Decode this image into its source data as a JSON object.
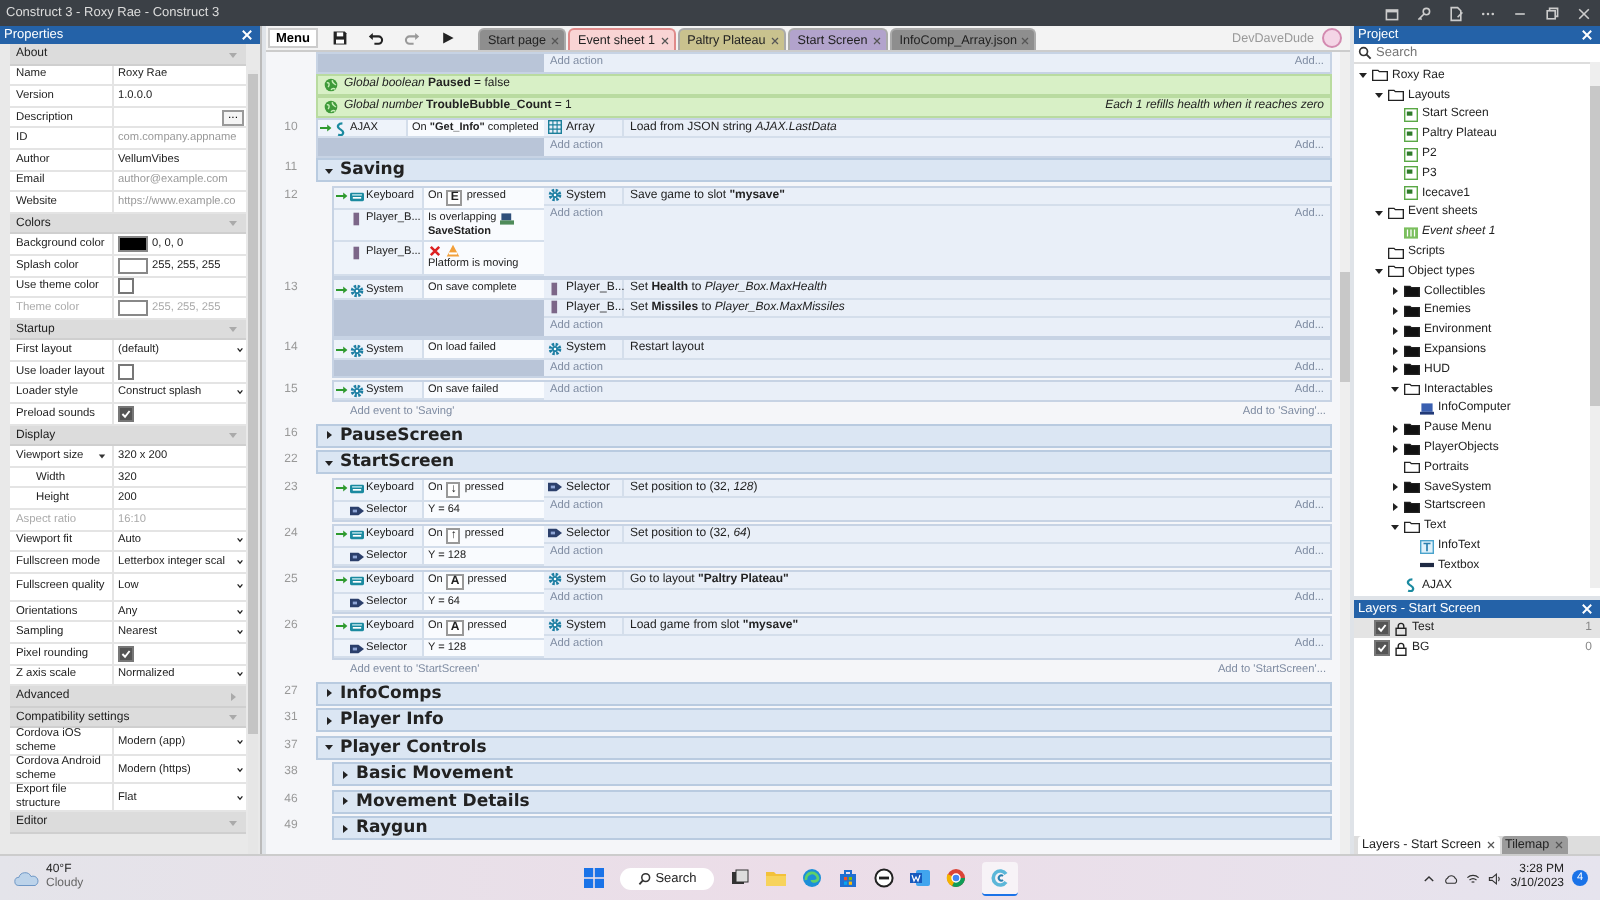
{
  "window": {
    "title": "Construct 3 - Roxy Rae - Construct 3"
  },
  "properties": {
    "title": "Properties",
    "sections": [
      {
        "name": "About",
        "expanded": true,
        "rows": [
          {
            "label": "Name",
            "kind": "text",
            "value": "Roxy Rae",
            "disabled": false
          },
          {
            "label": "Version",
            "kind": "text",
            "value": "1.0.0.0",
            "disabled": false
          },
          {
            "label": "Description",
            "kind": "button",
            "value": "...",
            "disabled": false
          },
          {
            "label": "ID",
            "kind": "text",
            "placeholder": "com.company.appname",
            "disabled": false
          },
          {
            "label": "Author",
            "kind": "text",
            "value": "VellumVibes",
            "disabled": false
          },
          {
            "label": "Email",
            "kind": "text",
            "placeholder": "author@example.com",
            "disabled": false
          },
          {
            "label": "Website",
            "kind": "text",
            "placeholder": "https://www.example.co",
            "disabled": false
          }
        ]
      },
      {
        "name": "Colors",
        "expanded": true,
        "rows": [
          {
            "label": "Background color",
            "kind": "color",
            "color": "#000000",
            "value": "0, 0, 0",
            "disabled": false
          },
          {
            "label": "Splash color",
            "kind": "color",
            "color": "#ffffff",
            "value": "255, 255, 255",
            "disabled": false
          },
          {
            "label": "Use theme color",
            "kind": "checkbox",
            "checked": false,
            "disabled": false
          },
          {
            "label": "Theme color",
            "kind": "color",
            "color": "#ffffff",
            "value": "255, 255, 255",
            "disabled": true
          }
        ]
      },
      {
        "name": "Startup",
        "expanded": true,
        "rows": [
          {
            "label": "First layout",
            "kind": "dropdown",
            "value": "(default)",
            "disabled": false
          },
          {
            "label": "Use loader layout",
            "kind": "checkbox",
            "checked": false,
            "disabled": false
          },
          {
            "label": "Loader style",
            "kind": "dropdown",
            "value": "Construct splash",
            "disabled": false
          },
          {
            "label": "Preload sounds",
            "kind": "checkbox",
            "checked": true,
            "disabled": false
          }
        ]
      },
      {
        "name": "Display",
        "expanded": true,
        "rows": [
          {
            "label": "Viewport size",
            "kind": "text",
            "value": "320 x 200",
            "disabled": false,
            "expanded": true,
            "children": [
              {
                "label": "Width",
                "kind": "text",
                "value": "320",
                "disabled": false
              },
              {
                "label": "Height",
                "kind": "text",
                "value": "200",
                "disabled": false
              }
            ]
          },
          {
            "label": "Aspect ratio",
            "kind": "text",
            "value": "16:10",
            "disabled": true
          },
          {
            "label": "Viewport fit",
            "kind": "dropdown",
            "value": "Auto",
            "disabled": false
          },
          {
            "label": "Fullscreen mode",
            "kind": "dropdown",
            "value": "Letterbox integer scal",
            "disabled": false
          },
          {
            "label": "Fullscreen quality",
            "kind": "dropdown",
            "value": "Low",
            "disabled": false
          },
          {
            "label": "Orientations",
            "kind": "dropdown",
            "value": "Any",
            "disabled": false
          },
          {
            "label": "Sampling",
            "kind": "dropdown",
            "value": "Nearest",
            "disabled": false
          },
          {
            "label": "Pixel rounding",
            "kind": "checkbox",
            "checked": true,
            "disabled": false
          },
          {
            "label": "Z axis scale",
            "kind": "dropdown",
            "value": "Normalized",
            "disabled": false
          }
        ]
      },
      {
        "name": "Advanced",
        "expanded": false
      },
      {
        "name": "Compatibility settings",
        "expanded": true,
        "rows": [
          {
            "label": "Cordova iOS scheme",
            "kind": "dropdown",
            "value": "Modern (app)",
            "disabled": false
          },
          {
            "label": "Cordova Android scheme",
            "kind": "dropdown",
            "value": "Modern (https)",
            "disabled": false
          },
          {
            "label": "Export file structure",
            "kind": "dropdown",
            "value": "Flat",
            "disabled": false
          }
        ]
      },
      {
        "name": "Editor",
        "expanded": true
      }
    ]
  },
  "toolbar": {
    "menu": "Menu",
    "user": "DevDaveDude"
  },
  "tabs": [
    {
      "label": "Start page",
      "selected": false,
      "color": "#8e8e8e"
    },
    {
      "label": "Event sheet 1",
      "selected": true,
      "color": "#f9d4d4"
    },
    {
      "label": "Paltry Plateau",
      "selected": false,
      "color": "#c9c28e"
    },
    {
      "label": "Start Screen",
      "selected": false,
      "color": "#b2a3cc"
    },
    {
      "label": "InfoComp_Array.json",
      "selected": false,
      "color": "#8e8e8e"
    }
  ],
  "event_sheet": {
    "blocks": [
      {
        "kind": "add-action",
        "text": "Add action",
        "more": "Add..."
      },
      {
        "kind": "global",
        "text": "*Global boolean* **Paused** = false"
      },
      {
        "kind": "global",
        "text": "*Global number* **TroubleBubble_Count** = 1",
        "comment": "Each 1 refills health when it reaches zero"
      },
      {
        "kind": "event",
        "number": "10",
        "conditions": [
          {
            "kind": "plain",
            "object": {
              "name": "AJAX",
              "kind": "ajax"
            },
            "inverted": false,
            "text": "On **\"Get_Info\"** completed"
          }
        ],
        "actions": [
          {
            "object": {
              "name": "Array",
              "kind": "array"
            },
            "text": "Load from JSON string *AJAX.LastData*"
          }
        ],
        "add_action": "Add action",
        "add_more": "Add..."
      },
      {
        "kind": "group",
        "number": "11",
        "title": "Saving",
        "expanded": true,
        "add_event": "Add event to 'Saving'",
        "add_more": "Add to 'Saving'...",
        "children": [
          {
            "kind": "event",
            "number": "12",
            "conditions": [
              {
                "kind": "key",
                "object": {
                  "name": "Keyboard",
                  "kind": "keyboard"
                },
                "inverted": false,
                "prefix": "On",
                "key": "E",
                "suffix": "pressed"
              },
              {
                "kind": "overlap",
                "object": {
                  "name": "Player_B...",
                  "kind": "sprite"
                },
                "inverted": false,
                "text": "Is overlapping",
                "target": "SaveStation"
              },
              {
                "kind": "behavior",
                "object": {
                  "name": "Player_B...",
                  "kind": "sprite"
                },
                "inverted": true,
                "text": "Platform is moving"
              }
            ],
            "actions": [
              {
                "object": {
                  "name": "System",
                  "kind": "system"
                },
                "text": "Save game to slot **\"mysave\"**"
              }
            ],
            "add_action": "Add action",
            "add_more": "Add..."
          },
          {
            "kind": "event",
            "number": "13",
            "conditions": [
              {
                "kind": "plain",
                "object": {
                  "name": "System",
                  "kind": "system"
                },
                "inverted": false,
                "text": "On save complete"
              }
            ],
            "actions": [
              {
                "object": {
                  "name": "Player_B...",
                  "kind": "sprite"
                },
                "text": "Set **Health** to *Player_Box.MaxHealth*"
              },
              {
                "object": {
                  "name": "Player_B...",
                  "kind": "sprite"
                },
                "text": "Set **Missiles** to *Player_Box.MaxMissiles*"
              }
            ],
            "add_action": "Add action",
            "add_more": "Add..."
          },
          {
            "kind": "event",
            "number": "14",
            "conditions": [
              {
                "kind": "plain",
                "object": {
                  "name": "System",
                  "kind": "system"
                },
                "inverted": false,
                "text": "On load failed"
              }
            ],
            "actions": [
              {
                "object": {
                  "name": "System",
                  "kind": "system"
                },
                "text": "Restart layout"
              }
            ],
            "add_action": "Add action",
            "add_more": "Add..."
          },
          {
            "kind": "event",
            "number": "15",
            "conditions": [
              {
                "kind": "plain",
                "object": {
                  "name": "System",
                  "kind": "system"
                },
                "inverted": false,
                "text": "On save failed"
              }
            ],
            "add_action": "Add action",
            "add_more": "Add..."
          }
        ]
      },
      {
        "kind": "group",
        "number": "16",
        "title": "PauseScreen",
        "expanded": false
      },
      {
        "kind": "group",
        "number": "22",
        "title": "StartScreen",
        "expanded": true,
        "add_event": "Add event to 'StartScreen'",
        "add_more": "Add to 'StartScreen'...",
        "children": [
          {
            "kind": "event",
            "number": "23",
            "conditions": [
              {
                "kind": "key",
                "object": {
                  "name": "Keyboard",
                  "kind": "keyboard"
                },
                "inverted": false,
                "prefix": "On",
                "key": "↓",
                "suffix": "pressed"
              },
              {
                "kind": "plain",
                "object": {
                  "name": "Selector",
                  "kind": "selector"
                },
                "inverted": false,
                "text": "Y = 64"
              }
            ],
            "actions": [
              {
                "object": {
                  "name": "Selector",
                  "kind": "selector"
                },
                "text": "Set position to (32, *128*)"
              }
            ],
            "add_action": "Add action",
            "add_more": "Add..."
          },
          {
            "kind": "event",
            "number": "24",
            "conditions": [
              {
                "kind": "key",
                "object": {
                  "name": "Keyboard",
                  "kind": "keyboard"
                },
                "inverted": false,
                "prefix": "On",
                "key": "↑",
                "suffix": "pressed"
              },
              {
                "kind": "plain",
                "object": {
                  "name": "Selector",
                  "kind": "selector"
                },
                "inverted": false,
                "text": "Y = 128"
              }
            ],
            "actions": [
              {
                "object": {
                  "name": "Selector",
                  "kind": "selector"
                },
                "text": "Set position to (32, *64*)"
              }
            ],
            "add_action": "Add action",
            "add_more": "Add..."
          },
          {
            "kind": "event",
            "number": "25",
            "conditions": [
              {
                "kind": "key",
                "object": {
                  "name": "Keyboard",
                  "kind": "keyboard"
                },
                "inverted": false,
                "prefix": "On",
                "key": "A",
                "suffix": "pressed"
              },
              {
                "kind": "plain",
                "object": {
                  "name": "Selector",
                  "kind": "selector"
                },
                "inverted": false,
                "text": "Y = 64"
              }
            ],
            "actions": [
              {
                "object": {
                  "name": "System",
                  "kind": "system"
                },
                "text": "Go to layout **\"Paltry Plateau\"**"
              }
            ],
            "add_action": "Add action",
            "add_more": "Add..."
          },
          {
            "kind": "event",
            "number": "26",
            "conditions": [
              {
                "kind": "key",
                "object": {
                  "name": "Keyboard",
                  "kind": "keyboard"
                },
                "inverted": false,
                "prefix": "On",
                "key": "A",
                "suffix": "pressed"
              },
              {
                "kind": "plain",
                "object": {
                  "name": "Selector",
                  "kind": "selector"
                },
                "inverted": false,
                "text": "Y = 128"
              }
            ],
            "actions": [
              {
                "object": {
                  "name": "System",
                  "kind": "system"
                },
                "text": "Load game from slot **\"mysave\"**"
              }
            ],
            "add_action": "Add action",
            "add_more": "Add..."
          }
        ]
      },
      {
        "kind": "group",
        "number": "27",
        "title": "InfoComps",
        "expanded": false
      },
      {
        "kind": "group",
        "number": "31",
        "title": "Player Info",
        "expanded": false
      },
      {
        "kind": "group",
        "number": "37",
        "title": "Player Controls",
        "expanded": true,
        "children": [
          {
            "kind": "group",
            "number": "38",
            "title": "Basic Movement",
            "expanded": false
          },
          {
            "kind": "group",
            "number": "46",
            "title": "Movement Details",
            "expanded": false
          },
          {
            "kind": "group",
            "number": "49",
            "title": "Raygun",
            "expanded": false
          }
        ]
      }
    ]
  },
  "project": {
    "title": "Project",
    "search": {
      "placeholder": "Search"
    },
    "tree": [
      {
        "label": "Roxy Rae",
        "kind": "folder",
        "expanded": true,
        "children": [
          {
            "label": "Layouts",
            "kind": "folder",
            "expanded": true,
            "children": [
              {
                "label": "Start Screen",
                "kind": "layout"
              },
              {
                "label": "Paltry Plateau",
                "kind": "layout"
              },
              {
                "label": "P2",
                "kind": "layout"
              },
              {
                "label": "P3",
                "kind": "layout"
              },
              {
                "label": "Icecave1",
                "kind": "layout"
              }
            ]
          },
          {
            "label": "Event sheets",
            "kind": "folder",
            "expanded": true,
            "children": [
              {
                "label": "Event sheet 1",
                "kind": "eventsheet"
              }
            ]
          },
          {
            "label": "Scripts",
            "kind": "folder"
          },
          {
            "label": "Object types",
            "kind": "folder",
            "expanded": true,
            "children": [
              {
                "label": "Collectibles",
                "kind": "folder",
                "expanded": false
              },
              {
                "label": "Enemies",
                "kind": "folder",
                "expanded": false
              },
              {
                "label": "Environment",
                "kind": "folder",
                "expanded": false
              },
              {
                "label": "Expansions",
                "kind": "folder",
                "expanded": false
              },
              {
                "label": "HUD",
                "kind": "folder",
                "expanded": false
              },
              {
                "label": "Interactables",
                "kind": "folder",
                "expanded": true,
                "children": [
                  {
                    "label": "InfoComputer",
                    "kind": "sprite"
                  }
                ]
              },
              {
                "label": "Pause Menu",
                "kind": "folder",
                "expanded": false
              },
              {
                "label": "PlayerObjects",
                "kind": "folder",
                "expanded": false
              },
              {
                "label": "Portraits",
                "kind": "folder"
              },
              {
                "label": "SaveSystem",
                "kind": "folder",
                "expanded": false
              },
              {
                "label": "Startscreen",
                "kind": "folder",
                "expanded": false
              },
              {
                "label": "Text",
                "kind": "folder",
                "expanded": true,
                "children": [
                  {
                    "label": "InfoText",
                    "kind": "text"
                  },
                  {
                    "label": "Textbox",
                    "kind": "textbox"
                  }
                ]
              },
              {
                "label": "AJAX",
                "kind": "ajax"
              }
            ]
          }
        ]
      }
    ]
  },
  "layers": {
    "title": "Layers - Start Screen",
    "rows": [
      {
        "name": "Test",
        "number": "1",
        "visible": true,
        "selected": true
      },
      {
        "name": "BG",
        "number": "0",
        "visible": true,
        "selected": false
      }
    ]
  },
  "bottom_tabs": [
    {
      "label": "Layers - Start Screen",
      "selected": true
    },
    {
      "label": "Tilemap",
      "selected": false
    }
  ],
  "taskbar": {
    "weather": {
      "temperature": "40°F",
      "condition": "Cloudy"
    },
    "search": "Search",
    "time": "3:28 PM",
    "date": "3/10/2023",
    "notifications": "4"
  }
}
